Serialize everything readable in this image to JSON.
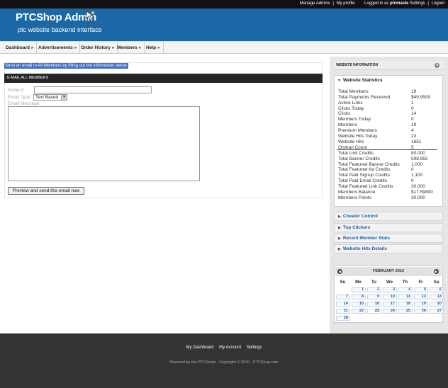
{
  "top": {
    "manage_admins": "Manage Admins",
    "my_profile": "My profile",
    "logged_in_prefix": "Logged in as",
    "username": "ptcmaste",
    "settings": "Settings",
    "logout": "Logout",
    "sep": "|"
  },
  "brand": {
    "title": "PTCShop Admin",
    "subtitle": "ptc website backend interface"
  },
  "nav": [
    "Dashboard »",
    "Advertisements »",
    "Order History »",
    "Members »",
    "Help »"
  ],
  "main": {
    "instruction": "Send an email to All Members by filling out the information below.",
    "section_title": "E-MAIL ALL MEMBERS",
    "subject_label": "Subject:",
    "subject_value": "",
    "type_label": "Email Type:",
    "type_value": "Text Based",
    "message_label": "Email Message:",
    "message_value": "",
    "preview_button": "Preview and send this email now"
  },
  "sidebar": {
    "header": "WEBSITE INFORMATION",
    "stats_title": "Website Statistics",
    "stats": [
      {
        "label": "Total Members",
        "value": "19"
      },
      {
        "label": "Total Payments Received",
        "value": "$49.9500"
      },
      {
        "label": "Active Links",
        "value": "1"
      },
      {
        "label": "Clicks Today",
        "value": "0"
      },
      {
        "label": "Clicks",
        "value": "14"
      },
      {
        "label": "Members Today",
        "value": "0"
      },
      {
        "label": "Members",
        "value": "19"
      },
      {
        "label": "Premium Members",
        "value": "4"
      },
      {
        "label": "Website Hits Today",
        "value": "23"
      },
      {
        "label": "Website Hits",
        "value": "1651"
      },
      {
        "label": "Orphan Count",
        "value": "5"
      },
      {
        "label": "Total Link Credits",
        "value": "80,000"
      },
      {
        "label": "Total Banner Credits",
        "value": "598,955"
      },
      {
        "label": "Total Featured Banner Credits",
        "value": "1,000"
      },
      {
        "label": "Total Featured Ad Credits",
        "value": "0"
      },
      {
        "label": "Total Paid Signup Credits",
        "value": "1,100"
      },
      {
        "label": "Total Paid Email Credits",
        "value": "0"
      },
      {
        "label": "Total Featured Link Credits",
        "value": "30,000"
      },
      {
        "label": "Members Balance",
        "value": "$17.59800"
      },
      {
        "label": "Members Points",
        "value": "30,000"
      }
    ],
    "accordions": [
      "Cheater Control",
      "Top Clickers",
      "Recent Member Stats",
      "Website Hits Details"
    ]
  },
  "calendar": {
    "month": "FEBRUARY 2010",
    "weekdays": [
      "Su",
      "Mo",
      "Tu",
      "We",
      "Th",
      "Fr",
      "Sa"
    ],
    "first_weekday": 1,
    "days": 28,
    "today": 23
  },
  "footer": {
    "links": [
      "My Dashboard",
      "My Account",
      "Settings"
    ],
    "copyright": "Powered by the PTCScript - Copyright © 2010 - PTCShop.com"
  },
  "colors": {
    "header_blue": "#1c68a6",
    "link_blue": "#1f5fa5",
    "footer_dark": "#333333",
    "highlight": "#3b6fc9"
  }
}
